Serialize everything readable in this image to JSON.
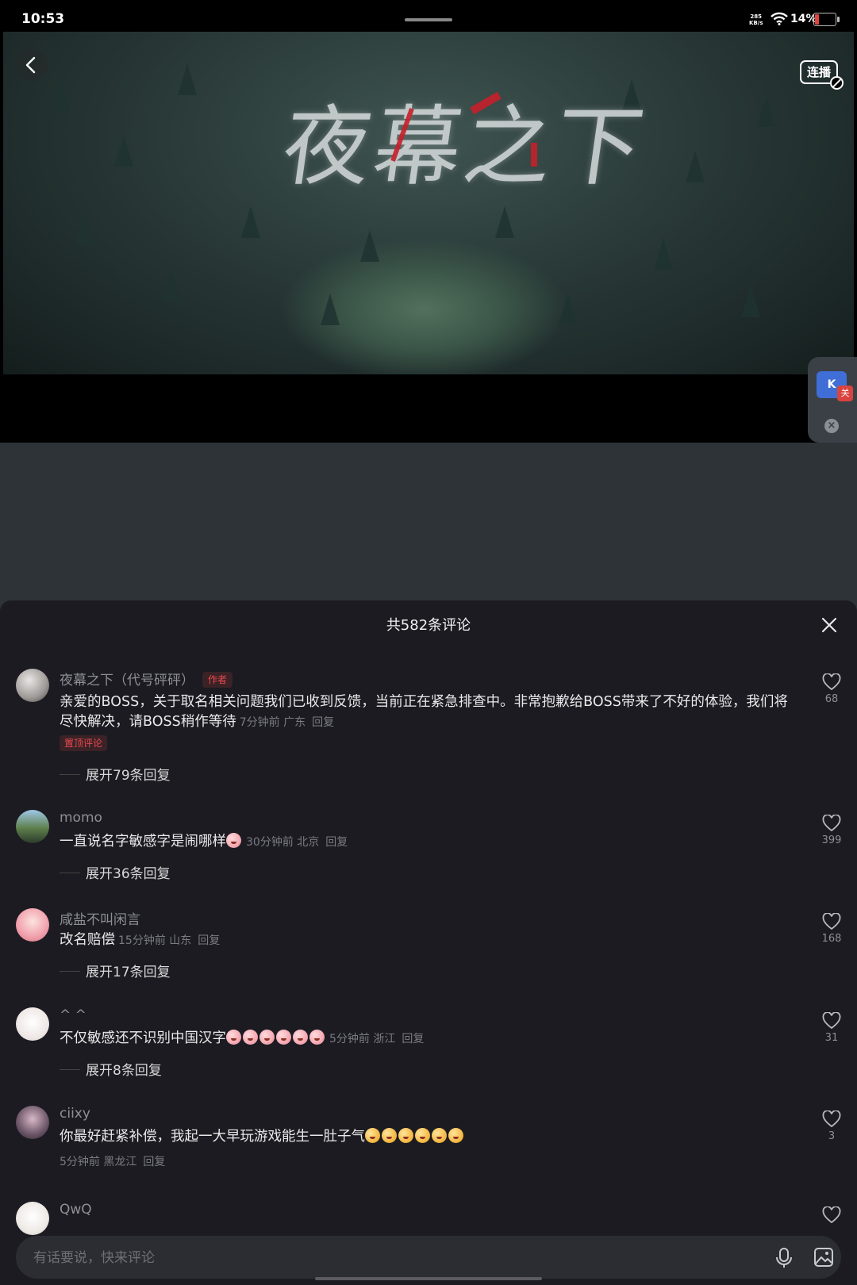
{
  "status_bar": {
    "time": "10:53",
    "net_speed": "285",
    "net_unit": "KB/s",
    "battery_pct": "14%"
  },
  "video": {
    "title_text": "夜幕之下",
    "autoplay_label": "连播"
  },
  "float_widget": {
    "label": "K",
    "badge": "关"
  },
  "comments_panel": {
    "title": "共582条评论",
    "comments": [
      {
        "user": "夜幕之下（代号砰砰）",
        "tag": "作者",
        "text": "亲爱的BOSS，关于取名相关问题我们已收到反馈，当前正在紧急排查中。非常抱歉给BOSS带来了不好的体验，我们将尽快解决，请BOSS稍作等待",
        "time": "7分钟前",
        "location": "广东",
        "reply": "回复",
        "pinned": "置顶评论",
        "expand": "展开79条回复",
        "likes": "68"
      },
      {
        "user": "momo",
        "text": "一直说名字敏感字是闹哪样",
        "time": "30分钟前",
        "location": "北京",
        "reply": "回复",
        "expand": "展开36条回复",
        "likes": "399"
      },
      {
        "user": "咸盐不叫闲言",
        "text": "改名赔偿",
        "time": "15分钟前",
        "location": "山东",
        "reply": "回复",
        "expand": "展开17条回复",
        "likes": "168"
      },
      {
        "user": "^ ^",
        "text": "不仅敏感还不识别中国汉字",
        "time": "5分钟前",
        "location": "浙江",
        "reply": "回复",
        "expand": "展开8条回复",
        "likes": "31"
      },
      {
        "user": "ciixy",
        "text": "你最好赶紧补偿，我起一大早玩游戏能生一肚子气",
        "time": "5分钟前",
        "location": "黑龙江",
        "reply": "回复",
        "likes": "3"
      },
      {
        "user": "QwQ"
      }
    ]
  },
  "input": {
    "placeholder": "有话要说，快来评论"
  }
}
